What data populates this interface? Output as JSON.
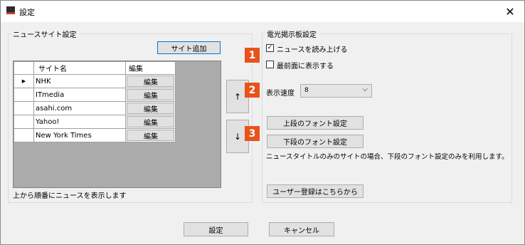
{
  "window": {
    "title": "設定",
    "close_glyph": "✕"
  },
  "news_sites": {
    "group_label": "ニュースサイト設定",
    "add_button": "サイト追加",
    "columns": [
      "サイト名",
      "編集"
    ],
    "rows": [
      {
        "name": "NHK",
        "edit": "編集",
        "current": "▶"
      },
      {
        "name": "ITmedia",
        "edit": "編集"
      },
      {
        "name": "asahi.com",
        "edit": "編集"
      },
      {
        "name": "Yahoo!",
        "edit": "編集"
      },
      {
        "name": "New York Times",
        "edit": "編集"
      }
    ],
    "up_button": "↑",
    "down_button": "↓",
    "footer_note": "上から順番にニュースを表示します"
  },
  "board": {
    "group_label": "電光掲示板設定",
    "read_aloud": {
      "label": "ニュースを読み上げる",
      "checked": true,
      "check_glyph": "✓"
    },
    "topmost": {
      "label": "最前面に表示する",
      "checked": false
    },
    "speed": {
      "label": "表示速度",
      "value": "8",
      "arrow": "⌵"
    },
    "upper_font_button": "上段のフォント設定",
    "lower_font_button": "下段のフォント設定",
    "font_note": "ニュースタイトルのみのサイトの場合、下段のフォント設定のみを利用します。",
    "register_button": "ユーザー登録はこちらから"
  },
  "badges": [
    "1",
    "2",
    "3"
  ],
  "footer": {
    "ok_button": "設定",
    "cancel_button": "キャンセル"
  },
  "colors": {
    "badge": "#e8531c",
    "focus_border": "#0078d7"
  }
}
